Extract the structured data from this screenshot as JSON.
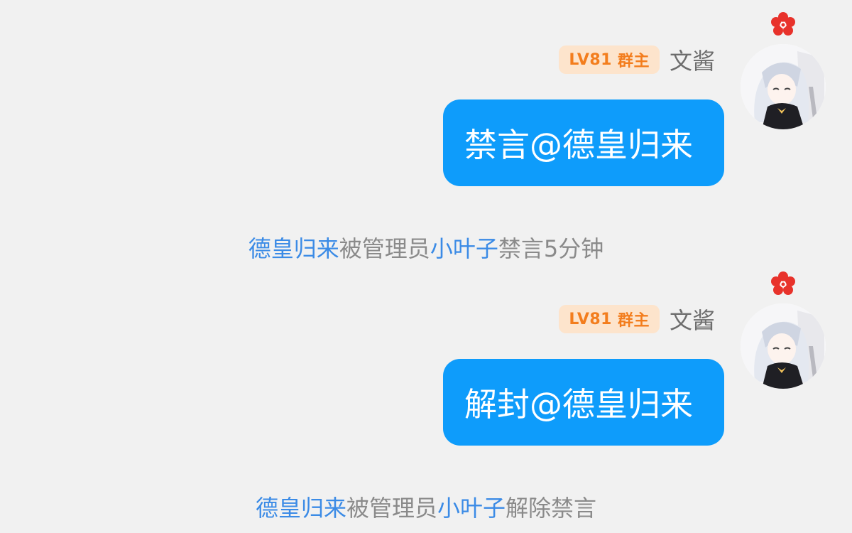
{
  "messages": [
    {
      "badge_level": "LV81",
      "badge_role": "群主",
      "sender": "文酱",
      "text": "禁言@德皇归来"
    },
    {
      "badge_level": "LV81",
      "badge_role": "群主",
      "sender": "文酱",
      "text": "解封@德皇归来"
    }
  ],
  "system_notices": [
    {
      "target": "德皇归来",
      "mid1": "被管理员",
      "admin": "小叶子",
      "action": "禁言5分钟"
    },
    {
      "target": "德皇归来",
      "mid1": "被管理员",
      "admin": "小叶子",
      "action": "解除禁言"
    }
  ],
  "colors": {
    "background": "#f1f1f1",
    "bubble": "#0e9cfb",
    "badge_bg": "#fde4cc",
    "badge_text": "#f37d1d",
    "link": "#3b8be6",
    "system_text": "#8a8a8a"
  }
}
